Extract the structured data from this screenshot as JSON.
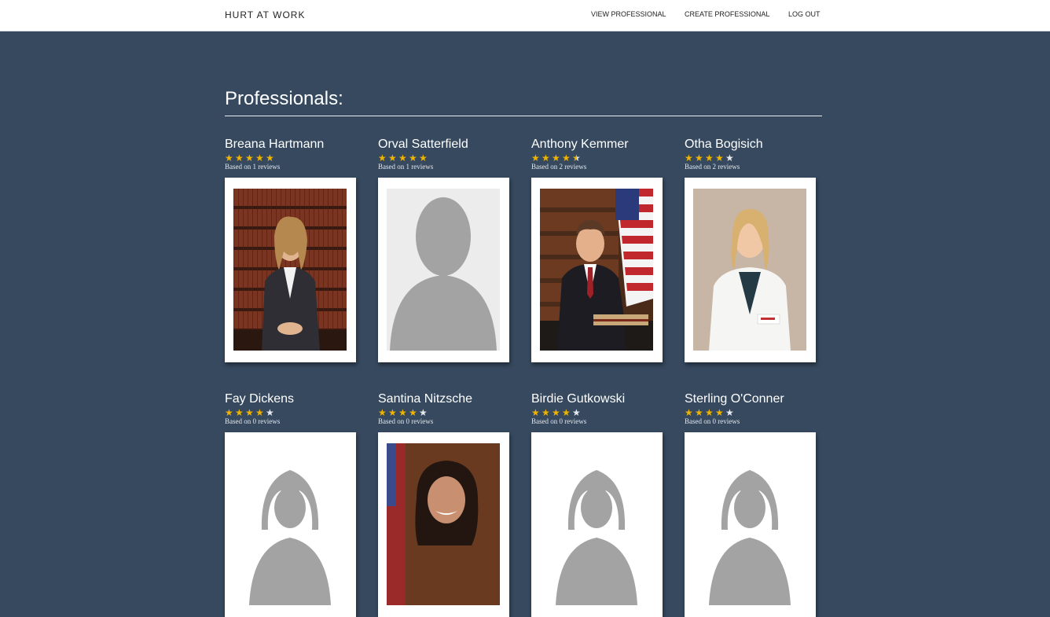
{
  "nav": {
    "brand": "HURT AT WORK",
    "links": [
      "VIEW PROFESSIONAL",
      "CREATE PROFESSIONAL",
      "LOG OUT"
    ]
  },
  "page": {
    "title": "Professionals:"
  },
  "colors": {
    "background": "#36495f",
    "star": "#f0b400",
    "star_empty": "#e6e9ee"
  },
  "professionals": [
    {
      "name": "Breana Hartmann",
      "rating": 5,
      "reviews_text": "Based on 1 reviews",
      "photo": "lawyer-woman-photo"
    },
    {
      "name": "Orval Satterfield",
      "rating": 5,
      "reviews_text": "Based on 1 reviews",
      "photo": "placeholder-avatar"
    },
    {
      "name": "Anthony Kemmer",
      "rating": 4.5,
      "reviews_text": "Based on 2 reviews",
      "photo": "lawyer-man-flag-photo"
    },
    {
      "name": "Otha Bogisich",
      "rating": 4,
      "reviews_text": "Based on 2 reviews",
      "photo": "physician-woman-photo"
    },
    {
      "name": "Fay Dickens",
      "rating": 4,
      "reviews_text": "Based on 0 reviews",
      "photo": "placeholder-avatar-female"
    },
    {
      "name": "Santina Nitzsche",
      "rating": 4,
      "reviews_text": "Based on 0 reviews",
      "photo": "official-woman-photo"
    },
    {
      "name": "Birdie Gutkowski",
      "rating": 4,
      "reviews_text": "Based on 0 reviews",
      "photo": "placeholder-avatar-female"
    },
    {
      "name": "Sterling O'Conner",
      "rating": 4,
      "reviews_text": "Based on 0 reviews",
      "photo": "placeholder-avatar-female"
    }
  ]
}
